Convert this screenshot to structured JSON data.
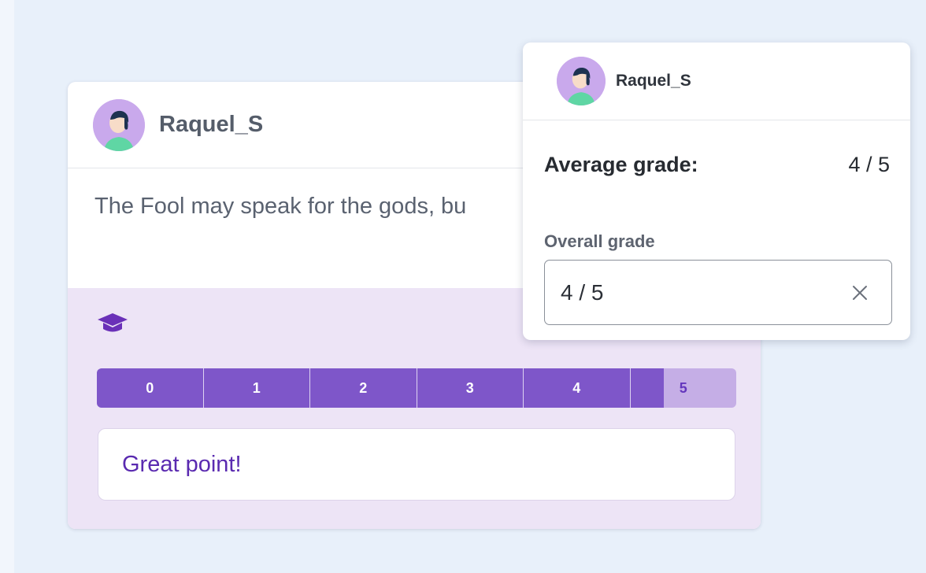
{
  "post": {
    "username": "Raquel_S",
    "text": "The Fool may speak for the gods, bu                       him.",
    "avatar_icon": "user-avatar-icon"
  },
  "grading": {
    "icon": "graduation-cap-icon",
    "scale": [
      "0",
      "1",
      "2",
      "3",
      "4",
      "5"
    ],
    "selected_grade": 4,
    "feedback": "Great point!"
  },
  "popup": {
    "username": "Raquel_S",
    "average_label": "Average grade:",
    "average_value": "4 / 5",
    "overall_label": "Overall grade",
    "overall_value": "4 / 5",
    "clear_icon": "close-icon"
  },
  "colors": {
    "accent": "#7e56c9",
    "accent_light": "#c5aee6",
    "grade_area_bg": "#ede4f6",
    "feedback_text": "#5a2ab0"
  }
}
